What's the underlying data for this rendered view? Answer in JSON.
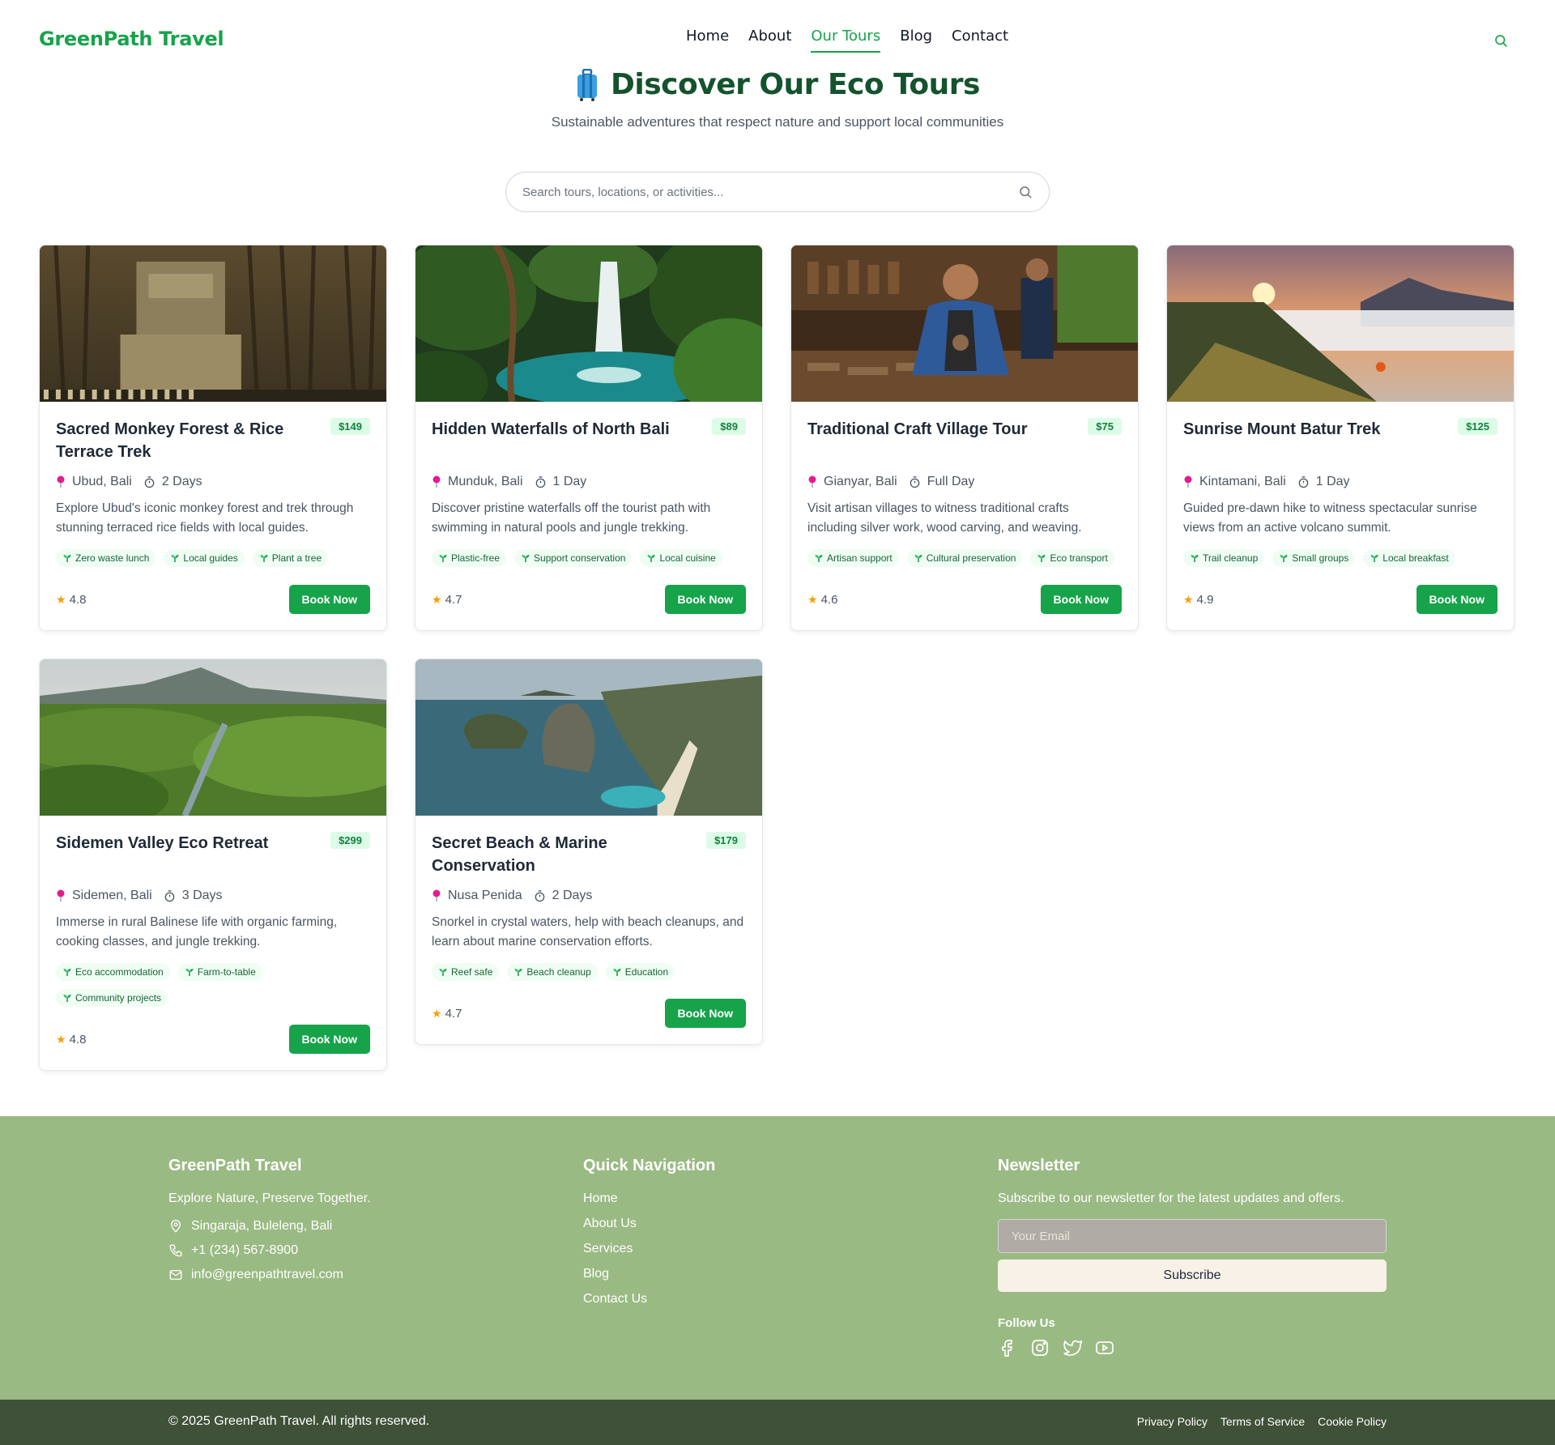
{
  "brand": "GreenPath Travel",
  "nav": [
    {
      "label": "Home",
      "active": false
    },
    {
      "label": "About",
      "active": false
    },
    {
      "label": "Our Tours",
      "active": true
    },
    {
      "label": "Blog",
      "active": false
    },
    {
      "label": "Contact",
      "active": false
    }
  ],
  "hero": {
    "title": "Discover Our Eco Tours",
    "subtitle": "Sustainable adventures that respect nature and support local communities"
  },
  "search": {
    "placeholder": "Search tours, locations, or activities..."
  },
  "tours": [
    {
      "title": "Sacred Monkey Forest & Rice Terrace Trek",
      "price": "$149",
      "location": "Ubud, Bali",
      "duration": "2 Days",
      "description": "Explore Ubud's iconic monkey forest and trek through stunning terraced rice fields with local guides.",
      "tags": [
        "Zero waste lunch",
        "Local guides",
        "Plant a tree"
      ],
      "rating": "4.8",
      "button": "Book Now",
      "image": "forest-temple"
    },
    {
      "title": "Hidden Waterfalls of North Bali",
      "price": "$89",
      "location": "Munduk, Bali",
      "duration": "1 Day",
      "description": "Discover pristine waterfalls off the tourist path with swimming in natural pools and jungle trekking.",
      "tags": [
        "Plastic-free",
        "Support conservation",
        "Local cuisine"
      ],
      "rating": "4.7",
      "button": "Book Now",
      "image": "waterfall"
    },
    {
      "title": "Traditional Craft Village Tour",
      "price": "$75",
      "location": "Gianyar, Bali",
      "duration": "Full Day",
      "description": "Visit artisan villages to witness traditional crafts including silver work, wood carving, and weaving.",
      "tags": [
        "Artisan support",
        "Cultural preservation",
        "Eco transport"
      ],
      "rating": "4.6",
      "button": "Book Now",
      "image": "craft-workshop"
    },
    {
      "title": "Sunrise Mount Batur Trek",
      "price": "$125",
      "location": "Kintamani, Bali",
      "duration": "1 Day",
      "description": "Guided pre-dawn hike to witness spectacular sunrise views from an active volcano summit.",
      "tags": [
        "Trail cleanup",
        "Small groups",
        "Local breakfast"
      ],
      "rating": "4.9",
      "button": "Book Now",
      "image": "volcano-sunrise"
    },
    {
      "title": "Sidemen Valley Eco Retreat",
      "price": "$299",
      "location": "Sidemen, Bali",
      "duration": "3 Days",
      "description": "Immerse in rural Balinese life with organic farming, cooking classes, and jungle trekking.",
      "tags": [
        "Eco accommodation",
        "Farm-to-table",
        "Community projects"
      ],
      "rating": "4.8",
      "button": "Book Now",
      "image": "green-valley"
    },
    {
      "title": "Secret Beach & Marine Conservation",
      "price": "$179",
      "location": "Nusa Penida",
      "duration": "2 Days",
      "description": "Snorkel in crystal waters, help with beach cleanups, and learn about marine conservation efforts.",
      "tags": [
        "Reef safe",
        "Beach cleanup",
        "Education"
      ],
      "rating": "4.7",
      "button": "Book Now",
      "image": "cliff-beach"
    }
  ],
  "footer": {
    "brand": "GreenPath Travel",
    "tagline": "Explore Nature, Preserve Together.",
    "address": "Singaraja, Buleleng, Bali",
    "phone": "+1 (234) 567-8900",
    "email": "info@greenpathtravel.com",
    "quick_nav_title": "Quick Navigation",
    "quick_links": [
      "Home",
      "About Us",
      "Services",
      "Blog",
      "Contact Us"
    ],
    "newsletter_title": "Newsletter",
    "newsletter_text": "Subscribe to our newsletter for the latest updates and offers.",
    "email_placeholder": "Your Email",
    "subscribe_label": "Subscribe",
    "follow_label": "Follow Us",
    "socials": [
      "facebook-icon",
      "instagram-icon",
      "twitter-icon",
      "youtube-icon"
    ]
  },
  "bottom": {
    "copyright": "© 2025 GreenPath Travel. All rights reserved.",
    "links": [
      "Privacy Policy",
      "Terms of Service",
      "Cookie Policy"
    ]
  },
  "colors": {
    "brand_green": "#16a34a",
    "title_green": "#14532d",
    "footer_bg": "#9aba83",
    "bottom_bg": "#3f5138",
    "price_bg": "#dcfce7"
  }
}
